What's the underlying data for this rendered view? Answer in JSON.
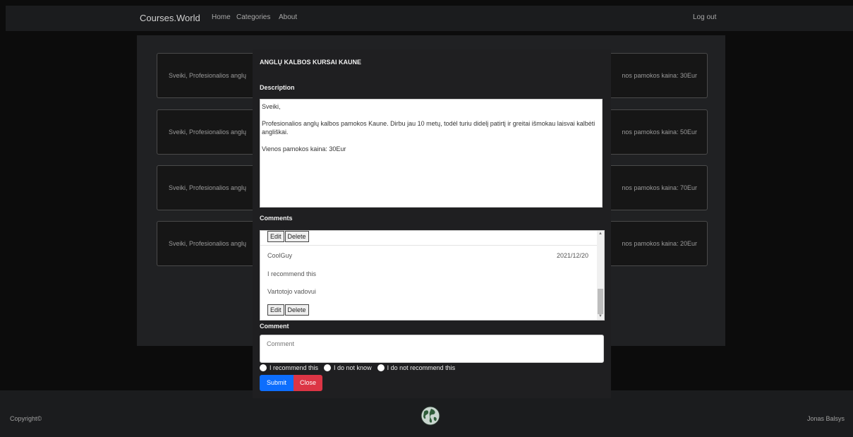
{
  "navbar": {
    "brand": "Courses.World",
    "links": [
      "Home",
      "Categories",
      "About"
    ],
    "logout": "Log out"
  },
  "courses": [
    {
      "left_text": "Sveiki, Profesionalios anglų",
      "right_text": "nos pamokos kaina: 30Eur"
    },
    {
      "left_text": "Sveiki, Profesionalios anglų",
      "right_text": "nos pamokos kaina: 50Eur"
    },
    {
      "left_text": "Sveiki, Profesionalios anglų",
      "right_text": "nos pamokos kaina: 70Eur"
    },
    {
      "left_text": "Sveiki, Profesionalios anglų",
      "right_text": "nos pamokos kaina: 20Eur"
    }
  ],
  "modal": {
    "title": "ANGLŲ KALBOS KURSAI KAUNE",
    "description_label": "Description",
    "description_lines": [
      "Sveiki,",
      "Profesionalios anglų kalbos pamokos Kaune. Dirbu jau 10 metų, todėl turiu didelį patirtį ir greitai išmokau laisvai kalbėti angliškai.",
      "Vienos pamokos kaina: 30Eur"
    ],
    "comments_label": "Comments",
    "edit_label": "Edit",
    "delete_label": "Delete",
    "comment": {
      "user": "CoolGuy",
      "date": "2021/12/20",
      "recommendation": "I recommend this",
      "text": "Vartotojo vadovui"
    },
    "comment_label": "Comment",
    "comment_placeholder": "Comment",
    "radio_options": [
      "I recommend this",
      "I do not know",
      "I do not recommend this"
    ],
    "submit_label": "Submit",
    "close_label": "Close"
  },
  "footer": {
    "copyright": "Copyright©",
    "author": "Jonas Balsys"
  },
  "colors": {
    "primary": "#0d6efd",
    "danger": "#dc3545",
    "navbar_bg": "#1b1c1e"
  }
}
